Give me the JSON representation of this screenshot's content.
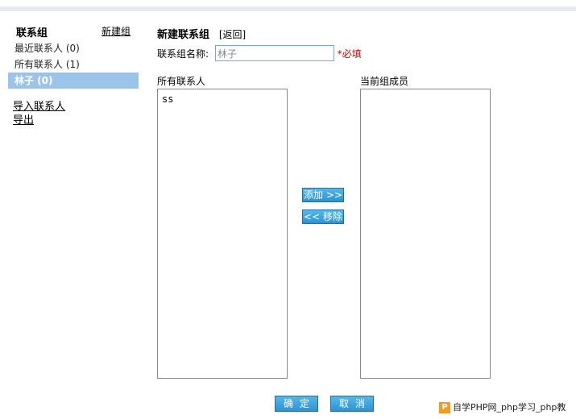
{
  "sidebar": {
    "title": "联系组",
    "new_group": "新建组",
    "items": [
      {
        "label": "最近联系人 (0)"
      },
      {
        "label": "所有联系人 (1)"
      },
      {
        "label": "林子 (0)"
      }
    ],
    "import": "导入联系人",
    "export": "导出"
  },
  "main": {
    "title": "新建联系组",
    "back": "[返回]",
    "name_label": "联系组名称:",
    "name_value": "林子",
    "required": "*必填",
    "all_contacts_label": "所有联系人",
    "members_label": "当前组成员",
    "all_contacts": [
      "ss"
    ],
    "members": [],
    "add_button": "添加 >>",
    "remove_button": "<< 移除"
  },
  "footer": {
    "ok": "确定",
    "cancel": "取消"
  },
  "watermark": {
    "icon": "P",
    "text": "自学PHP网_php学习_php教"
  },
  "colors": {
    "accent": "#9cc4ea",
    "button": "#2e93d1",
    "required": "#cc0000"
  }
}
